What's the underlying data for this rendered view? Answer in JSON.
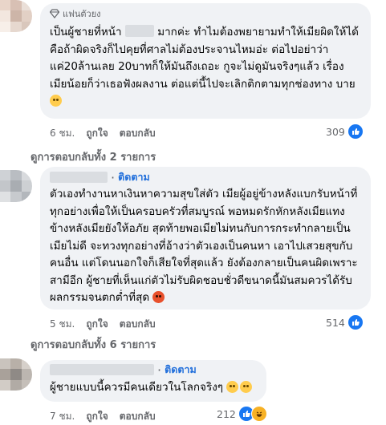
{
  "comments": [
    {
      "badge": "แฟนตัวยง",
      "text_before_blur": "เป็นผู้ชายที่หน้า",
      "text_after_blur": "มากค่ะ ทำไมต้องพยายามทำให้เมียผิดให้ได้ คือถ้าผิดจริงก็ไปคุยที่ศาลไม่ต้องประจานไหมอ่ะ ต่อไปอย่าว่าแค่20ล้านเลย 20บาทก็ให้มันถึงเถอะ กูจะไม่ดูมันจริงๆแล้ว เรื่องเมียน้อยก็ว่าเธอฟังผลงาน ต่อแต่นี้ไปจะเลิกติกตามทุกช่องทาง บาย",
      "end_emoji": "face-with-rolling-eyes",
      "time": "6 ชม.",
      "like": "ถูกใจ",
      "reply": "ตอบกลับ",
      "reaction_count": "309",
      "reaction_icons": [
        "like-icon"
      ],
      "view_replies": "ดูการตอบกลับทั้ง 2 รายการ"
    },
    {
      "follow": "ติดตาม",
      "text": "ตัวเองทำงานหาเงินหาความสุขใส่ตัว เมียผู้อยู่ข้างหลังแบกรับหน้าที่ทุกอย่างเพื่อให้เป็นครอบครัวที่สมบูรณ์ พอหมดรักหักหลังเมียแทงข้างหลังเมียยังให้อภัย สุดท้ายพอเมียไม่ทนกับการกระทำกลายเป็นเมียไม่ดี จะทวงทุกอย่างที่อ้างว่าตัวเองเป็นคนหา เอาไปเสวยสุขกับคนอื่น แต่โดนนอกใจก็เสียใจที่สุดแล้ว ยังต้องกลายเป็นคนผิดเพราะสามีอีก ผู้ชายที่เห็นแก่ตัวไม่รับผิดชอบชั่วดีขนาดนี้มันสมควรได้รับผลกรรมจนตกต่ำที่สุด",
      "end_emoji": "angry-face",
      "time": "5 ชม.",
      "like": "ถูกใจ",
      "reply": "ตอบกลับ",
      "reaction_count": "514",
      "reaction_icons": [
        "like-icon"
      ],
      "view_replies": "ดูการตอบกลับทั้ง 6 รายการ"
    },
    {
      "follow": "ติดตาม",
      "text": "ผู้ชายแบบนี้ควรมีคนเดียวในโลกจริงๆ",
      "end_emoji": "smirking-face",
      "time": "7 ชม.",
      "like": "ถูกใจ",
      "reply": "ตอบกลับ",
      "reaction_count": "212",
      "reaction_icons": [
        "like-icon",
        "haha-icon"
      ]
    }
  ],
  "colors": {
    "bubble": "#f0f2f5",
    "link_blue": "#216fdb",
    "meta_gray": "#65676b",
    "like_blue": "#1877f2",
    "haha_yellow": "#f7b125"
  }
}
